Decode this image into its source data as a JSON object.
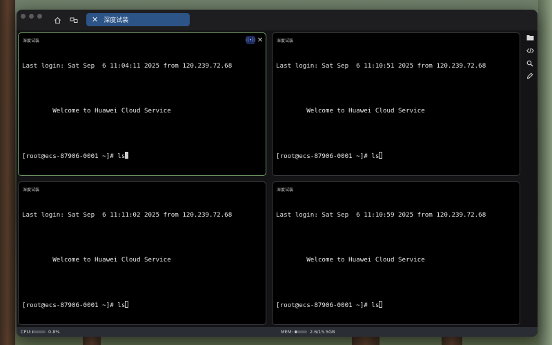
{
  "app": {
    "tab_title": "深度试装",
    "tab_close": "✕"
  },
  "panes": [
    {
      "title": "深度试装",
      "last_login": "Last login: Sat Sep  6 11:04:11 2025 from 120.239.72.68",
      "welcome": "        Welcome to Huawei Cloud Service",
      "prompt": "[root@ecs-87906-0001 ~]# ls",
      "active": true
    },
    {
      "title": "深度试装",
      "last_login": "Last login: Sat Sep  6 11:10:51 2025 from 120.239.72.68",
      "welcome": "        Welcome to Huawei Cloud Service",
      "prompt": "[root@ecs-87906-0001 ~]# ls",
      "active": false
    },
    {
      "title": "深度试装",
      "last_login": "Last login: Sat Sep  6 11:11:02 2025 from 120.239.72.68",
      "welcome": "        Welcome to Huawei Cloud Service",
      "prompt": "[root@ecs-87906-0001 ~]# ls",
      "active": false
    },
    {
      "title": "深度试装",
      "last_login": "Last login: Sat Sep  6 11:10:59 2025 from 120.239.72.68",
      "welcome": "        Welcome to Huawei Cloud Service",
      "prompt": "[root@ecs-87906-0001 ~]# ls",
      "active": false
    }
  ],
  "pane_controls": {
    "broadcast_label": "((•))",
    "close_label": "✕"
  },
  "sidebar_icons": [
    "folder-icon",
    "code-icon",
    "search-icon",
    "pen-icon"
  ],
  "titlebar_icons": [
    "home-icon",
    "servers-icon"
  ],
  "status": {
    "cpu_label": "CPU:",
    "cpu_value": "0.8%",
    "cpu_fraction": 0.008,
    "mem_label": "MEM:",
    "mem_value": "2.6/15.5GB",
    "mem_fraction": 0.168
  },
  "colors": {
    "tab_active": "#2c5487",
    "active_pane_border": "#6e9a63",
    "status_bar": "#2a2d33"
  }
}
